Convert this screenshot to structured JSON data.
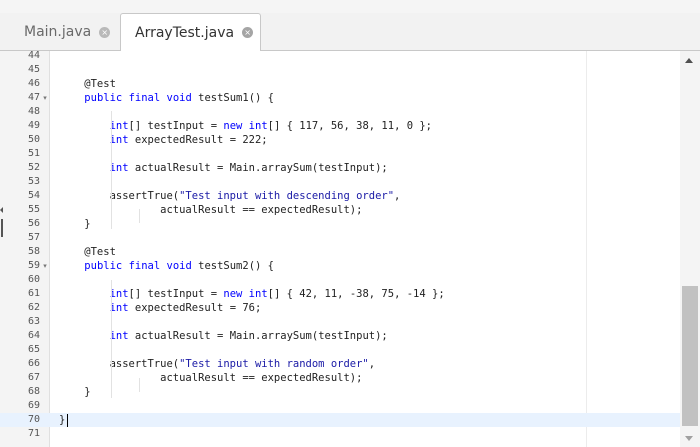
{
  "tabs": [
    {
      "label": "Main.java",
      "active": false
    },
    {
      "label": "ArrayTest.java",
      "active": true
    }
  ],
  "close_glyph": "×",
  "code_lines": [
    {
      "num": "44",
      "text": ""
    },
    {
      "num": "45",
      "text": ""
    },
    {
      "num": "46",
      "text": "    @Test"
    },
    {
      "num": "47",
      "text": "    public final void testSum1() {",
      "fold": "▾"
    },
    {
      "num": "48",
      "text": ""
    },
    {
      "num": "49",
      "text": "        int[] testInput = new int[] { 117, 56, 38, 11, 0 };"
    },
    {
      "num": "50",
      "text": "        int expectedResult = 222;"
    },
    {
      "num": "51",
      "text": ""
    },
    {
      "num": "52",
      "text": "        int actualResult = Main.arraySum(testInput);"
    },
    {
      "num": "53",
      "text": ""
    },
    {
      "num": "54",
      "text": "        assertTrue(\"Test input with descending order\","
    },
    {
      "num": "55",
      "text": "                actualResult == expectedResult);"
    },
    {
      "num": "56",
      "text": "    }"
    },
    {
      "num": "57",
      "text": ""
    },
    {
      "num": "58",
      "text": "    @Test"
    },
    {
      "num": "59",
      "text": "    public final void testSum2() {",
      "fold": "▾"
    },
    {
      "num": "60",
      "text": ""
    },
    {
      "num": "61",
      "text": "        int[] testInput = new int[] { 42, 11, -38, 75, -14 };"
    },
    {
      "num": "62",
      "text": "        int expectedResult = 76;"
    },
    {
      "num": "63",
      "text": ""
    },
    {
      "num": "64",
      "text": "        int actualResult = Main.arraySum(testInput);"
    },
    {
      "num": "65",
      "text": ""
    },
    {
      "num": "66",
      "text": "        assertTrue(\"Test input with random order\","
    },
    {
      "num": "67",
      "text": "                actualResult == expectedResult);"
    },
    {
      "num": "68",
      "text": "    }"
    },
    {
      "num": "69",
      "text": ""
    },
    {
      "num": "70",
      "text": "}",
      "active": true
    },
    {
      "num": "71",
      "text": ""
    }
  ],
  "colors": {
    "keyword": "#0000ff",
    "string": "#1a1aa6",
    "active_line": "#e8f2fe",
    "gutter": "#f4f4f4"
  },
  "icons": {
    "tab_close": "close-icon",
    "fold": "fold-arrow-icon",
    "scroll_up": "scroll-up-icon",
    "scroll_down": "scroll-down-icon"
  }
}
